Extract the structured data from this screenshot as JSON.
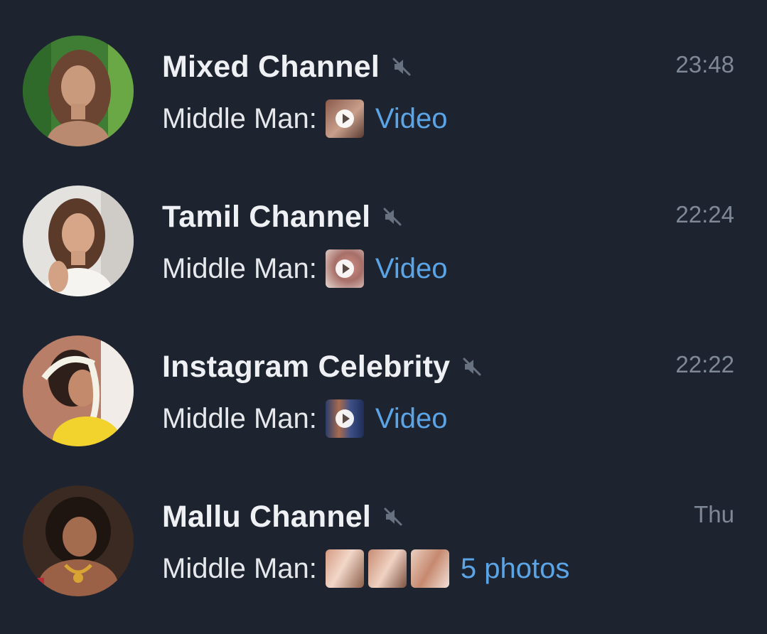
{
  "colors": {
    "background": "#1d2430",
    "title": "#eef0f3",
    "time": "#7f8896",
    "media_link": "#5ba4e6",
    "mute_icon": "#687180"
  },
  "chats": [
    {
      "title": "Mixed Channel",
      "muted": true,
      "time": "23:48",
      "sender": "Middle Man:",
      "media_label": "Video",
      "media_type": "video",
      "avatar_icon": "avatar-photo"
    },
    {
      "title": "Tamil Channel",
      "muted": true,
      "time": "22:24",
      "sender": "Middle Man:",
      "media_label": "Video",
      "media_type": "video",
      "avatar_icon": "avatar-photo"
    },
    {
      "title": "Instagram Celebrity",
      "muted": true,
      "time": "22:22",
      "sender": "Middle Man:",
      "media_label": "Video",
      "media_type": "video",
      "avatar_icon": "avatar-photo"
    },
    {
      "title": "Mallu Channel",
      "muted": true,
      "time": "Thu",
      "sender": "Middle Man:",
      "media_label": "5 photos",
      "media_type": "photo-album",
      "avatar_icon": "avatar-photo"
    }
  ]
}
